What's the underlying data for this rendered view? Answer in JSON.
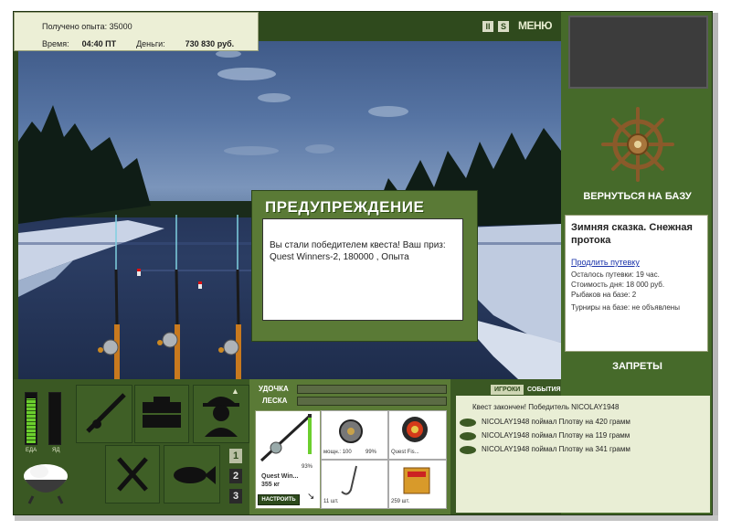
{
  "hud": {
    "xp_line": "Получено опыта: 35000",
    "time_label": "Время:",
    "time_value": "04:40 ПТ",
    "money_label": "Деньги:",
    "money_value": "730 830 руб."
  },
  "topbar": {
    "pause_icon_text": "II",
    "sound_icon_text": "S",
    "menu_label": "МЕНЮ"
  },
  "base": {
    "back_label": "ВЕРНУТЬСЯ НА БАЗУ",
    "location_title": "Зимняя сказка. Снежная протока",
    "extend_link": "Продлить путевку",
    "rows": [
      "Осталось путевки: 19 час.",
      "Стоимость дня: 18 000 руб.",
      "Рыбаков на базе: 2",
      "Турниры на базе: не объявлены"
    ],
    "forbid_label": "ЗАПРЕТЫ"
  },
  "modal": {
    "title": "ПРЕДУПРЕЖДЕНИЕ",
    "text": "Вы стали победителем квеста! Ваш приз: Quest Winners-2, 180000 , Опыта"
  },
  "gauges": {
    "food_label": "ЕДА",
    "poison_label": "ЯД",
    "food_level": 0.9,
    "poison_level": 0.0
  },
  "page_buttons": [
    "1",
    "2",
    "3"
  ],
  "rod_panel": {
    "rod_label": "УДОЧКА",
    "line_label": "ЛЕСКА",
    "rod_name": "Quest Win...",
    "rod_weight": "355 кг",
    "rod_percent": "93%",
    "setup_button": "НАСТРОИТЬ",
    "reel_info": "мощн.: 100",
    "reel_percent": "99%",
    "bait_name": "Quest Fis...",
    "hooks_count": "11 шт.",
    "bait_count": "259 шт."
  },
  "chat": {
    "tab_players": "ИГРОКИ",
    "tab_events": "СОБЫТИЯ",
    "messages": [
      "Квест закончен! Победитель NICOLAY1948",
      "NICOLAY1948 поймал Плотву на 420 грамм",
      "NICOLAY1948 поймал Плотву на 119 грамм",
      "NICOLAY1948 поймал Плотву на 341 грамм"
    ]
  },
  "colors": {
    "panel_green": "#466a2a",
    "dark_green": "#2f4a1d",
    "hud_bg": "#ecefd6"
  }
}
